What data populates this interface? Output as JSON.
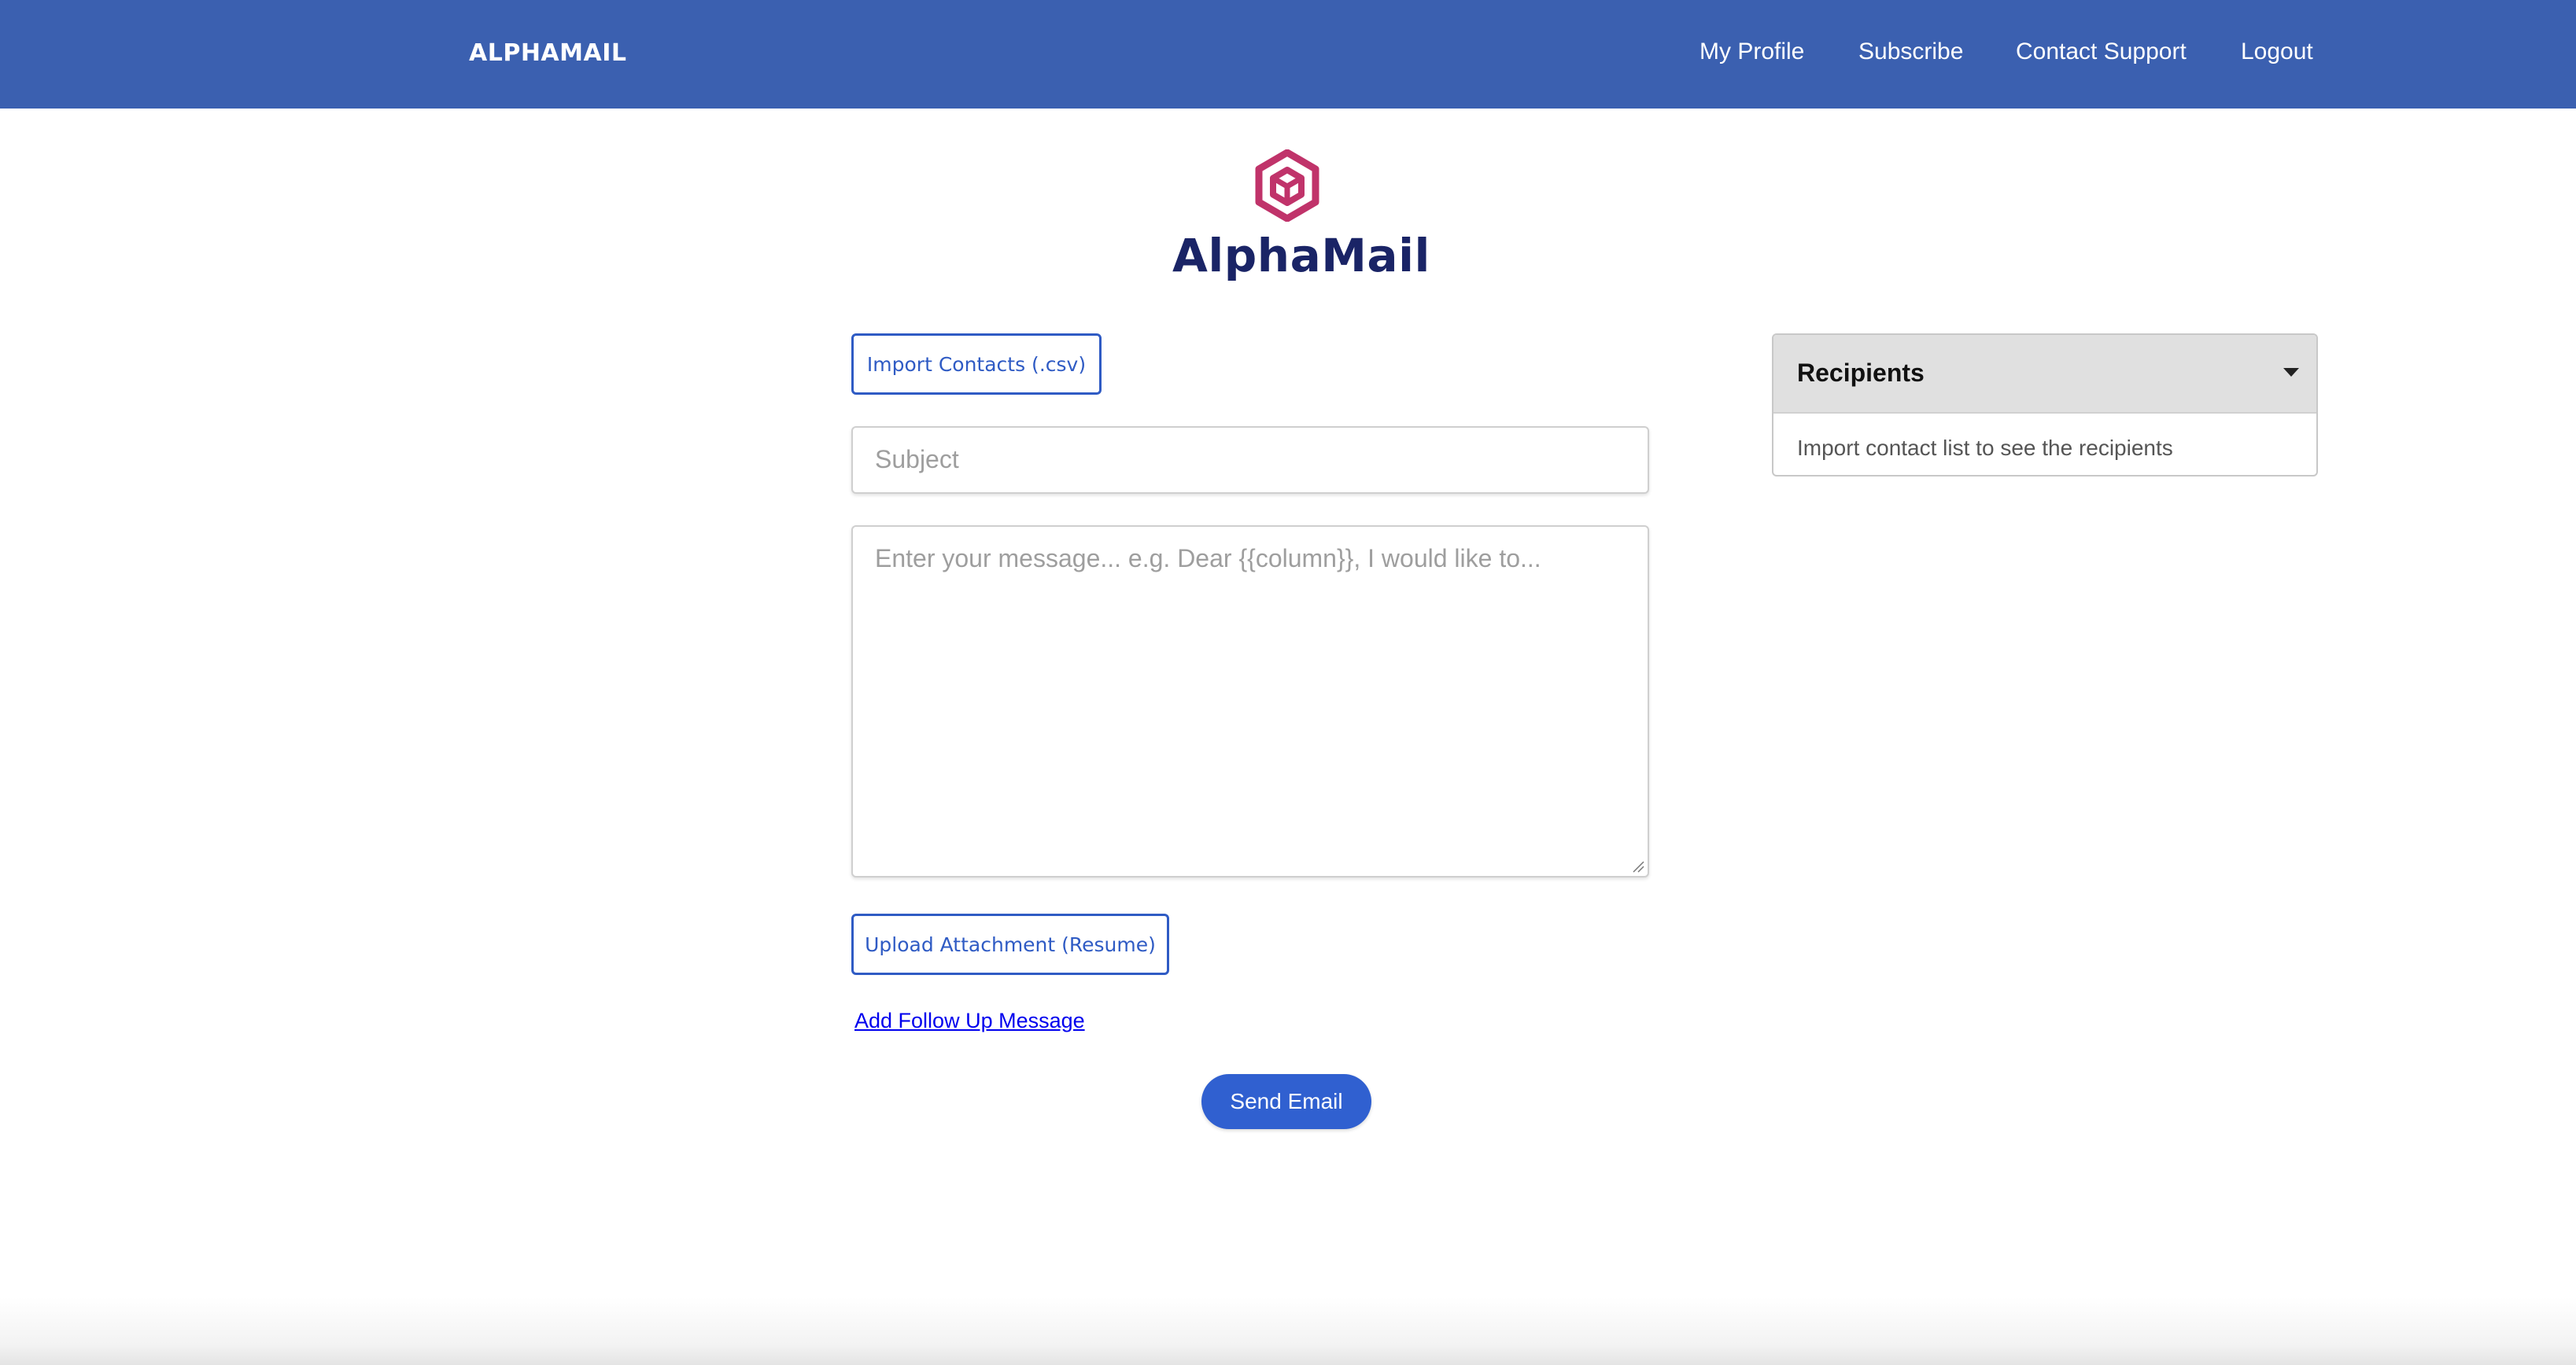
{
  "navbar": {
    "brand": "ALPHAMAIL",
    "links": [
      "My Profile",
      "Subscribe",
      "Contact Support",
      "Logout"
    ],
    "background": "#3b60b0"
  },
  "logo": {
    "icon": "hexagon-cube-icon",
    "text": "AlphaMail",
    "icon_color": "#c0336a",
    "text_color": "#1a2466"
  },
  "form": {
    "import_button": "Import Contacts (.csv)",
    "subject_placeholder": "Subject",
    "message_placeholder": "Enter your message...   e.g. Dear {{column}}, I would like to...",
    "upload_button": "Upload Attachment (Resume)",
    "followup_link": "Add Follow Up Message",
    "send_button": "Send Email",
    "accent": "#3060d0"
  },
  "recipients": {
    "title": "Recipients",
    "empty_text": "Import contact list to see the recipients",
    "toggle_icon": "caret-down-icon"
  }
}
